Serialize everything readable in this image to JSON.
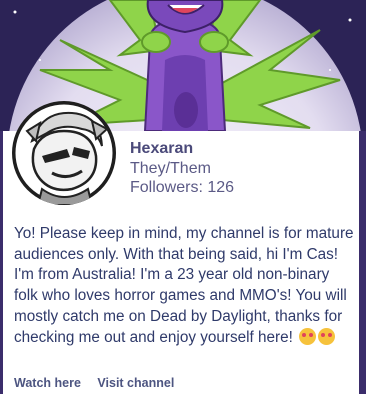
{
  "profile": {
    "name": "Hexaran",
    "pronouns": "They/Them",
    "followers": "Followers: 126"
  },
  "bio": {
    "text": "Yo! Please keep in mind, my channel is for mature audiences only. With that being said, hi I'm Cas! I'm from Australia! I'm a 23 year old non-binary folk who loves horror games and MMO's! You will mostly catch me on Dead by Daylight, thanks for checking me out and enjoy yourself here!",
    "emojis": [
      "smiling-face-with-hearts-icon",
      "smiling-face-with-hearts-icon"
    ]
  },
  "links": {
    "watch": "Watch here",
    "visit": "Visit channel"
  },
  "colors": {
    "banner_bg": "#2c2356",
    "accent": "#4b4a7a",
    "bio_text": "#2f3a6a"
  }
}
